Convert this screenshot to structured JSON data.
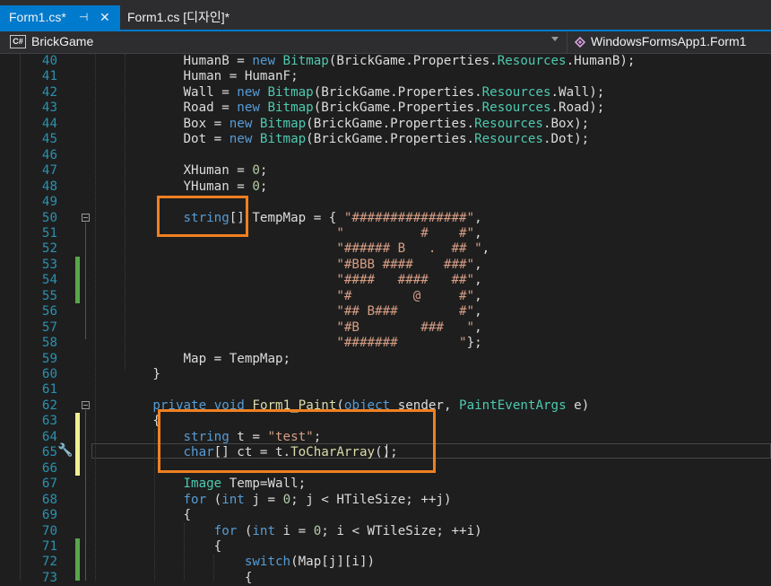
{
  "tabs": [
    {
      "label": "Form1.cs*",
      "pin": "⊣",
      "close": "✕"
    },
    {
      "label": "Form1.cs [디자인]*"
    }
  ],
  "nav": {
    "lang_icon": "C#",
    "project": "BrickGame",
    "class": "WindowsFormsApp1.Form1"
  },
  "lines": [
    {
      "n": "40",
      "t": [
        [
          "",
          "            HumanB = "
        ],
        [
          "kw",
          "new"
        ],
        [
          "",
          " "
        ],
        [
          "ty",
          "Bitmap"
        ],
        [
          "",
          "(BrickGame.Properties."
        ],
        [
          "ty",
          "Resources"
        ],
        [
          "",
          ".HumanB);"
        ]
      ]
    },
    {
      "n": "41",
      "t": [
        [
          "",
          "            Human = HumanF;"
        ]
      ]
    },
    {
      "n": "42",
      "t": [
        [
          "",
          "            Wall = "
        ],
        [
          "kw",
          "new"
        ],
        [
          "",
          " "
        ],
        [
          "ty",
          "Bitmap"
        ],
        [
          "",
          "(BrickGame.Properties."
        ],
        [
          "ty",
          "Resources"
        ],
        [
          "",
          ".Wall);"
        ]
      ]
    },
    {
      "n": "43",
      "t": [
        [
          "",
          "            Road = "
        ],
        [
          "kw",
          "new"
        ],
        [
          "",
          " "
        ],
        [
          "ty",
          "Bitmap"
        ],
        [
          "",
          "(BrickGame.Properties."
        ],
        [
          "ty",
          "Resources"
        ],
        [
          "",
          ".Road);"
        ]
      ]
    },
    {
      "n": "44",
      "t": [
        [
          "",
          "            Box = "
        ],
        [
          "kw",
          "new"
        ],
        [
          "",
          " "
        ],
        [
          "ty",
          "Bitmap"
        ],
        [
          "",
          "(BrickGame.Properties."
        ],
        [
          "ty",
          "Resources"
        ],
        [
          "",
          ".Box);"
        ]
      ]
    },
    {
      "n": "45",
      "t": [
        [
          "",
          "            Dot = "
        ],
        [
          "kw",
          "new"
        ],
        [
          "",
          " "
        ],
        [
          "ty",
          "Bitmap"
        ],
        [
          "",
          "(BrickGame.Properties."
        ],
        [
          "ty",
          "Resources"
        ],
        [
          "",
          ".Dot);"
        ]
      ]
    },
    {
      "n": "46",
      "t": []
    },
    {
      "n": "47",
      "t": [
        [
          "",
          "            XHuman = "
        ],
        [
          "num",
          "0"
        ],
        [
          "",
          ";"
        ]
      ]
    },
    {
      "n": "48",
      "t": [
        [
          "",
          "            YHuman = "
        ],
        [
          "num",
          "0"
        ],
        [
          "",
          ";"
        ]
      ]
    },
    {
      "n": "49",
      "t": []
    },
    {
      "n": "50",
      "t": [
        [
          "",
          "            "
        ],
        [
          "kw",
          "string"
        ],
        [
          "",
          "[] TempMap = { "
        ],
        [
          "str",
          "\"###############\""
        ],
        [
          "",
          ","
        ]
      ]
    },
    {
      "n": "51",
      "t": [
        [
          "",
          "                                "
        ],
        [
          "str",
          "\"          #    #\""
        ],
        [
          "",
          ","
        ]
      ]
    },
    {
      "n": "52",
      "t": [
        [
          "",
          "                                "
        ],
        [
          "str",
          "\"###### B   .  ## \""
        ],
        [
          "",
          ","
        ]
      ]
    },
    {
      "n": "53",
      "t": [
        [
          "",
          "                                "
        ],
        [
          "str",
          "\"#BBB ####    ###\""
        ],
        [
          "",
          ","
        ]
      ]
    },
    {
      "n": "54",
      "t": [
        [
          "",
          "                                "
        ],
        [
          "str",
          "\"####   ####   ##\""
        ],
        [
          "",
          ","
        ]
      ]
    },
    {
      "n": "55",
      "t": [
        [
          "",
          "                                "
        ],
        [
          "str",
          "\"#        @     #\""
        ],
        [
          "",
          ","
        ]
      ]
    },
    {
      "n": "56",
      "t": [
        [
          "",
          "                                "
        ],
        [
          "str",
          "\"## B###        #\""
        ],
        [
          "",
          ","
        ]
      ]
    },
    {
      "n": "57",
      "t": [
        [
          "",
          "                                "
        ],
        [
          "str",
          "\"#B        ###   \""
        ],
        [
          "",
          ","
        ]
      ]
    },
    {
      "n": "58",
      "t": [
        [
          "",
          "                                "
        ],
        [
          "str",
          "\"#######        \""
        ],
        [
          "",
          "};"
        ]
      ]
    },
    {
      "n": "59",
      "t": [
        [
          "",
          "            Map = TempMap;"
        ]
      ]
    },
    {
      "n": "60",
      "t": [
        [
          "",
          "        }"
        ]
      ]
    },
    {
      "n": "61",
      "t": []
    },
    {
      "n": "62",
      "t": [
        [
          "",
          "        "
        ],
        [
          "kw",
          "private"
        ],
        [
          "",
          " "
        ],
        [
          "kw",
          "void"
        ],
        [
          "",
          " "
        ],
        [
          "mth",
          "Form1_Paint"
        ],
        [
          "",
          "("
        ],
        [
          "kw",
          "object"
        ],
        [
          "",
          " sender, "
        ],
        [
          "ty",
          "PaintEventArgs"
        ],
        [
          "",
          " e)"
        ]
      ]
    },
    {
      "n": "63",
      "t": [
        [
          "",
          "        {"
        ]
      ]
    },
    {
      "n": "64",
      "t": [
        [
          "",
          "            "
        ],
        [
          "kw",
          "string"
        ],
        [
          "",
          " t = "
        ],
        [
          "str",
          "\"test\""
        ],
        [
          "",
          ";"
        ]
      ]
    },
    {
      "n": "65",
      "t": [
        [
          "",
          "            "
        ],
        [
          "kw",
          "char"
        ],
        [
          "",
          "[] ct = t."
        ],
        [
          "mth",
          "ToCharArray"
        ],
        [
          "",
          "();"
        ]
      ]
    },
    {
      "n": "66",
      "t": []
    },
    {
      "n": "67",
      "t": [
        [
          "",
          "            "
        ],
        [
          "ty",
          "Image"
        ],
        [
          "",
          " Temp=Wall;"
        ]
      ]
    },
    {
      "n": "68",
      "t": [
        [
          "",
          "            "
        ],
        [
          "kw",
          "for"
        ],
        [
          "",
          " ("
        ],
        [
          "kw",
          "int"
        ],
        [
          "",
          " j = "
        ],
        [
          "num",
          "0"
        ],
        [
          "",
          "; j < HTileSize; ++j)"
        ]
      ]
    },
    {
      "n": "69",
      "t": [
        [
          "",
          "            {"
        ]
      ]
    },
    {
      "n": "70",
      "t": [
        [
          "",
          "                "
        ],
        [
          "kw",
          "for"
        ],
        [
          "",
          " ("
        ],
        [
          "kw",
          "int"
        ],
        [
          "",
          " i = "
        ],
        [
          "num",
          "0"
        ],
        [
          "",
          "; i < WTileSize; ++i)"
        ]
      ]
    },
    {
      "n": "71",
      "t": [
        [
          "",
          "                {"
        ]
      ]
    },
    {
      "n": "72",
      "t": [
        [
          "",
          "                    "
        ],
        [
          "kw",
          "switch"
        ],
        [
          "",
          "(Map[j][i])"
        ]
      ]
    },
    {
      "n": "73",
      "t": [
        [
          "",
          "                    {"
        ]
      ]
    }
  ]
}
